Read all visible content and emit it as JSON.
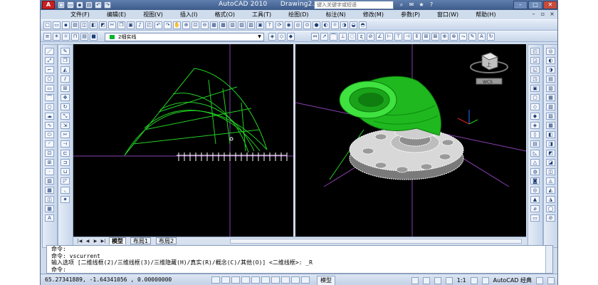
{
  "title_bar": {
    "app_name": "AutoCAD 2010",
    "document": "Drawing2.dwg",
    "search_placeholder": "键入关键字或短语",
    "logo_letter": "A"
  },
  "menu": {
    "items": [
      "文件(F)",
      "编辑(E)",
      "视图(V)",
      "插入(I)",
      "格式(O)",
      "工具(T)",
      "绘图(D)",
      "标注(N)",
      "修改(M)",
      "参数(P)",
      "窗口(W)",
      "帮助(H)"
    ]
  },
  "layer_toolbar": {
    "current_layer": "2细实线",
    "layer_color": "#14b814"
  },
  "viewcube": {
    "label": "上",
    "wcs_label": "WCS"
  },
  "layout_tabs": {
    "tabs": [
      "模型",
      "布局1",
      "布局2"
    ],
    "active": "模型"
  },
  "command_window": {
    "lines": [
      "命令:",
      "命令:  vscurrent",
      "输入选项 [二维线框(2)/三维线框(3)/三维隐藏(H)/真实(R)/概念(C)/其他(O)] <二维线框>: _R",
      "命令:"
    ]
  },
  "status_bar": {
    "coordinates": "65.27341889,  -1.64341056 , 0.00000000",
    "model_label": "模型",
    "scale": "1:1",
    "workspace": "AutoCAD 经典"
  },
  "colors": {
    "accent_green": "#14b814",
    "canvas": "#000000",
    "wireframe": "#22d022",
    "axis_purple": "#8a3fb0"
  }
}
